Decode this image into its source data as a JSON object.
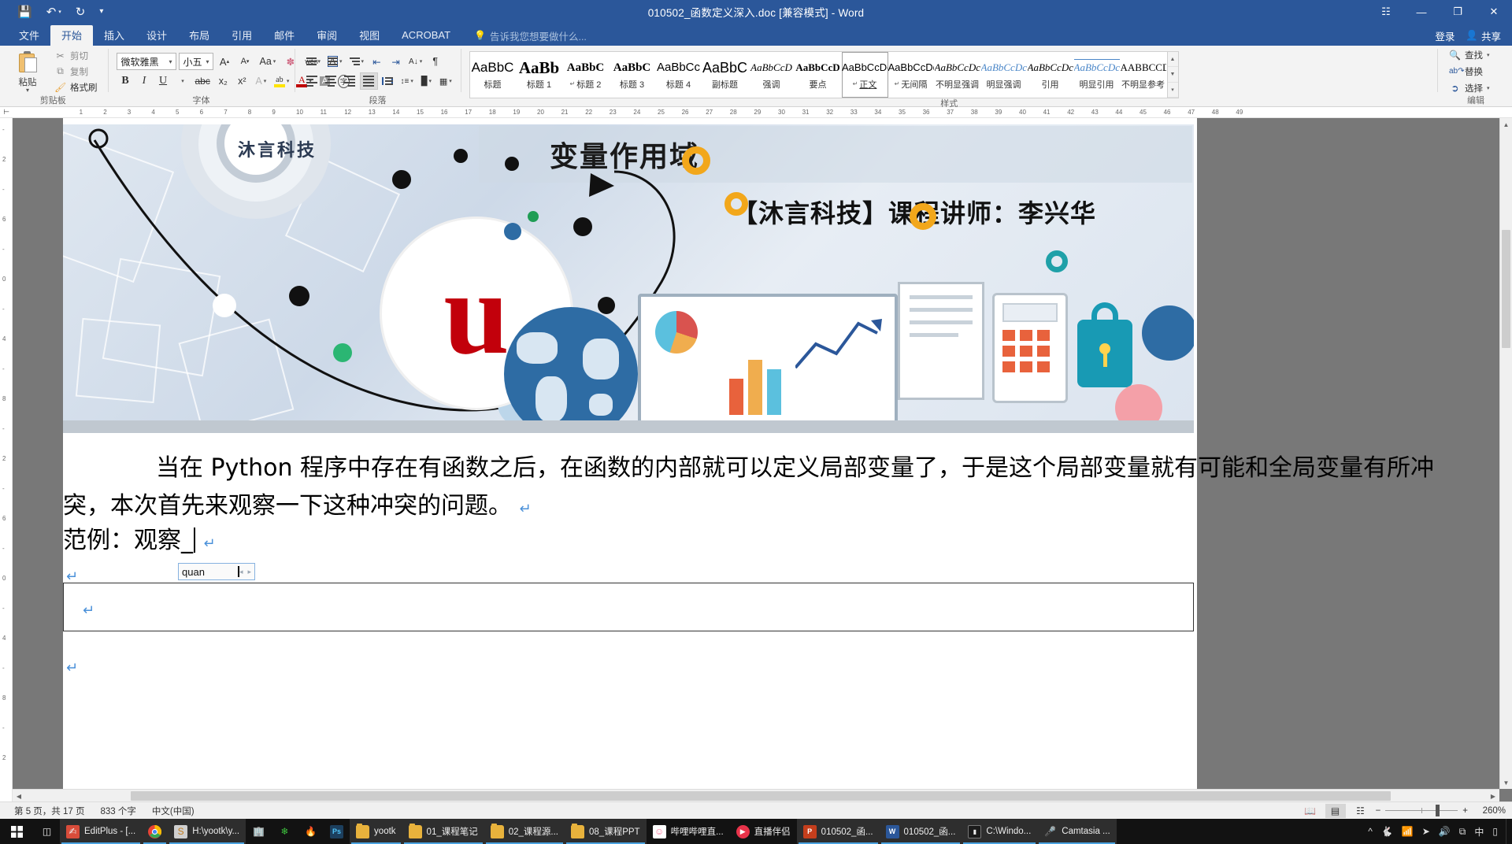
{
  "window": {
    "title": "010502_函数定义深入.doc [兼容模式] - Word",
    "qat": [
      {
        "name": "save",
        "glyph": "💾"
      },
      {
        "name": "undo",
        "glyph": "↶"
      },
      {
        "name": "undo-dropdown",
        "glyph": "▾"
      },
      {
        "name": "redo",
        "glyph": "↻"
      },
      {
        "name": "customize-qat",
        "glyph": "☰"
      }
    ],
    "controls": {
      "ribbon_display": "⌧",
      "minimize": "—",
      "restore": "❐",
      "close": "✕"
    }
  },
  "tabs": [
    {
      "label": "文件",
      "active": false
    },
    {
      "label": "开始",
      "active": true
    },
    {
      "label": "插入",
      "active": false
    },
    {
      "label": "设计",
      "active": false
    },
    {
      "label": "布局",
      "active": false
    },
    {
      "label": "引用",
      "active": false
    },
    {
      "label": "邮件",
      "active": false
    },
    {
      "label": "审阅",
      "active": false
    },
    {
      "label": "视图",
      "active": false
    },
    {
      "label": "ACROBAT",
      "active": false
    }
  ],
  "tell_me": "告诉我您想要做什么...",
  "account": {
    "signin": "登录",
    "share": "共享"
  },
  "ribbon": {
    "clipboard": {
      "group_label": "剪贴板",
      "paste_label": "粘贴",
      "cut_label": "剪切",
      "copy_label": "复制",
      "format_painter_label": "格式刷"
    },
    "font": {
      "group_label": "字体",
      "font_name": "微软雅黑",
      "font_size": "小五",
      "grow_label": "A",
      "shrink_label": "A",
      "change_case_label": "Aa",
      "clear_format_label": "⌧",
      "phonetic_label": "wén",
      "border_label": "A",
      "bold_label": "B",
      "italic_label": "I",
      "underline_label": "U",
      "strike_label": "abc",
      "subscript_label": "x₂",
      "superscript_label": "x²",
      "text_effects_label": "A",
      "highlight_label": "ab",
      "font_color_label": "A",
      "char_shading_label": "A",
      "char_border_label": "字"
    },
    "paragraph": {
      "group_label": "段落",
      "bullets": "bullet-list",
      "numbering": "numbered-list",
      "multilevel": "multilevel-list",
      "decrease_indent": "decrease-indent",
      "increase_indent": "increase-indent",
      "sort": "sort",
      "show_marks": "show-formatting-marks",
      "align_left": "align-left",
      "align_center": "align-center",
      "align_right": "align-right",
      "justify": "justify",
      "distribute": "distribute",
      "line_spacing": "line-spacing",
      "shading": "shading",
      "borders": "borders"
    },
    "styles": {
      "group_label": "样式",
      "items": [
        {
          "preview": "AaBbC",
          "name": "标题",
          "pilcrow": false,
          "selected": false
        },
        {
          "preview": "AaBb",
          "name": "标题 1",
          "pilcrow": false,
          "selected": false
        },
        {
          "preview": "AaBbC",
          "name": "标题 2",
          "pilcrow": true,
          "selected": false
        },
        {
          "preview": "AaBbC",
          "name": "标题 3",
          "pilcrow": false,
          "selected": false
        },
        {
          "preview": "AaBbCc",
          "name": "标题 4",
          "pilcrow": false,
          "selected": false
        },
        {
          "preview": "AaBbC",
          "name": "副标题",
          "pilcrow": false,
          "selected": false
        },
        {
          "preview": "AaBbCcD",
          "name": "强调",
          "pilcrow": false,
          "selected": false
        },
        {
          "preview": "AaBbCcD",
          "name": "要点",
          "pilcrow": false,
          "selected": false
        },
        {
          "preview": "AaBbCcDc",
          "name": "正文",
          "pilcrow": true,
          "selected": true
        },
        {
          "preview": "AaBbCcDc",
          "name": "无间隔",
          "pilcrow": true,
          "selected": false
        },
        {
          "preview": "AaBbCcDc",
          "name": "不明显强调",
          "pilcrow": false,
          "selected": false
        },
        {
          "preview": "AaBbCcDc",
          "name": "明显强调",
          "pilcrow": false,
          "selected": false
        },
        {
          "preview": "AaBbCcDc",
          "name": "引用",
          "pilcrow": false,
          "selected": false
        },
        {
          "preview": "AaBbCcDc",
          "name": "明显引用",
          "pilcrow": false,
          "selected": false
        },
        {
          "preview": "AABBCCD",
          "name": "不明显参考",
          "pilcrow": false,
          "selected": false
        }
      ]
    },
    "editing": {
      "group_label": "编辑",
      "find_label": "查找",
      "replace_label": "替换",
      "select_label": "选择"
    }
  },
  "document": {
    "banner": {
      "title": "变量作用域",
      "brand": "沐言科技",
      "instructor": "【沐言科技】课程讲师：李兴华",
      "logo_letter": "u"
    },
    "paragraphs": [
      "当在 Python 程序中存在有函数之后，在函数的内部就可以定义局部变量了，于是这个局部变量就有可能和全局变量有所冲",
      "突，本次首先来观察一下这种冲突的问题。",
      "范例：观察_"
    ],
    "pilcrow": "↵",
    "ime": {
      "composition": "quan",
      "prev": "◂",
      "next": "▸"
    }
  },
  "status": {
    "page_info": "第 5 页，共 17 页",
    "word_count": "833 个字",
    "language": "中文(中国)",
    "views": [
      {
        "name": "read-mode",
        "glyph": "📖",
        "active": false
      },
      {
        "name": "print-layout",
        "glyph": "☰",
        "active": true
      },
      {
        "name": "web-layout",
        "glyph": "🌐",
        "active": false
      }
    ],
    "zoom_out": "−",
    "zoom_in": "+",
    "zoom_level": "260%"
  },
  "taskbar": {
    "start": "start-icon",
    "task_view": "task-view-icon",
    "items": [
      {
        "label": "EditPlus - [...",
        "icon": "editplus",
        "active": true
      },
      {
        "label": "",
        "icon": "chrome",
        "active": true
      },
      {
        "label": "H:\\yootk\\y...",
        "icon": "explorer-s",
        "active": true
      },
      {
        "label": "",
        "icon": "app-house",
        "active": false
      },
      {
        "label": "",
        "icon": "green-app",
        "active": false
      },
      {
        "label": "",
        "icon": "firefox",
        "active": false
      },
      {
        "label": "",
        "icon": "photoshop",
        "active": false
      },
      {
        "label": "yootk",
        "icon": "folder",
        "active": true
      },
      {
        "label": "01_课程笔记",
        "icon": "folder",
        "active": true
      },
      {
        "label": "02_课程源...",
        "icon": "folder",
        "active": true
      },
      {
        "label": "08_课程PPT",
        "icon": "folder",
        "active": true
      },
      {
        "label": "哔哩哔哩直...",
        "icon": "bilibili",
        "active": false
      },
      {
        "label": "直播伴侣",
        "icon": "live-companion",
        "active": false
      },
      {
        "label": "010502_函...",
        "icon": "powerpoint",
        "active": true
      },
      {
        "label": "010502_函...",
        "icon": "word",
        "active": true
      },
      {
        "label": "C:\\Windo...",
        "icon": "cmd",
        "active": true
      },
      {
        "label": "Camtasia ...",
        "icon": "camtasia",
        "active": true
      }
    ],
    "tray": [
      {
        "name": "show-hidden-icons",
        "glyph": "∧"
      },
      {
        "name": "thunder-app",
        "glyph": "🐦"
      },
      {
        "name": "network",
        "glyph": "📶"
      },
      {
        "name": "onedrive",
        "glyph": "➤"
      },
      {
        "name": "volume",
        "glyph": "🔊"
      },
      {
        "name": "copy-tool",
        "glyph": "⧉"
      },
      {
        "name": "ime-chinese",
        "glyph": "中"
      },
      {
        "name": "action-center",
        "glyph": "▭"
      }
    ]
  }
}
